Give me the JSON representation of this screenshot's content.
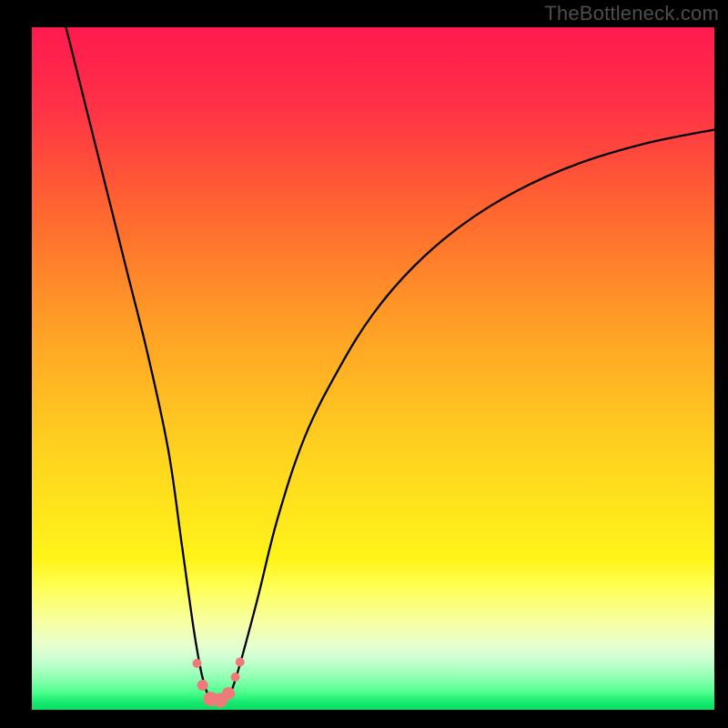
{
  "watermark": "TheBottleneck.com",
  "layout": {
    "margin_left": 35,
    "margin_right": 15,
    "margin_top": 30,
    "margin_bottom": 20
  },
  "gradient": {
    "stops": [
      {
        "offset": 0.0,
        "color": "#ff1a4f"
      },
      {
        "offset": 0.12,
        "color": "#ff3246"
      },
      {
        "offset": 0.28,
        "color": "#ff6a2e"
      },
      {
        "offset": 0.45,
        "color": "#ffa326"
      },
      {
        "offset": 0.62,
        "color": "#ffd21f"
      },
      {
        "offset": 0.78,
        "color": "#fff41a"
      },
      {
        "offset": 0.82,
        "color": "#ffff55"
      },
      {
        "offset": 0.87,
        "color": "#f7ffa0"
      },
      {
        "offset": 0.905,
        "color": "#e8ffcf"
      },
      {
        "offset": 0.928,
        "color": "#c6ffd0"
      },
      {
        "offset": 0.955,
        "color": "#8bffb0"
      },
      {
        "offset": 0.975,
        "color": "#4cff8c"
      },
      {
        "offset": 0.99,
        "color": "#12e86d"
      },
      {
        "offset": 1.0,
        "color": "#0fdc66"
      }
    ]
  },
  "chart_data": {
    "type": "line",
    "title": "",
    "xlabel": "",
    "ylabel": "",
    "xlim": [
      0,
      100
    ],
    "ylim": [
      0,
      100
    ],
    "series": [
      {
        "name": "bottleneck-curve",
        "x": [
          5,
          8,
          11,
          14,
          17,
          20,
          22,
          24,
          25.5,
          27,
          28.5,
          30,
          33,
          36,
          40,
          45,
          50,
          56,
          63,
          71,
          80,
          90,
          100
        ],
        "y": [
          100,
          88,
          76,
          64,
          52,
          38,
          24,
          10,
          3,
          1,
          1.5,
          5,
          16,
          28,
          40,
          50,
          58,
          65,
          71,
          76,
          80,
          83,
          85
        ]
      }
    ],
    "markers": {
      "name": "highlight-dots",
      "color": "#ef7a7a",
      "points": [
        {
          "x": 24.2,
          "y": 6.8,
          "r": 5
        },
        {
          "x": 25.0,
          "y": 3.6,
          "r": 6
        },
        {
          "x": 26.2,
          "y": 1.6,
          "r": 8
        },
        {
          "x": 27.6,
          "y": 1.4,
          "r": 8
        },
        {
          "x": 28.8,
          "y": 2.4,
          "r": 7
        },
        {
          "x": 29.8,
          "y": 4.8,
          "r": 5
        },
        {
          "x": 30.5,
          "y": 7.0,
          "r": 5
        }
      ]
    }
  }
}
